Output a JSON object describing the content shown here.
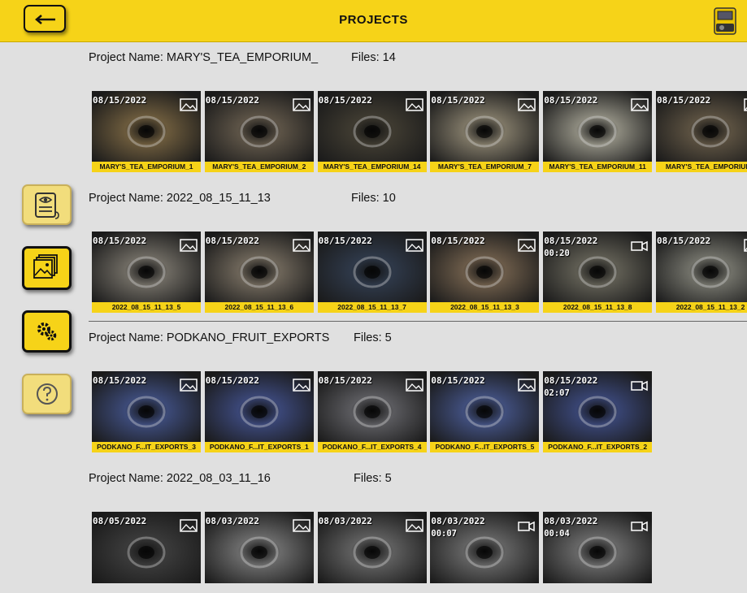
{
  "header": {
    "title": "PROJECTS",
    "back_icon": "arrow-left-icon",
    "device_icon": "camera-device-icon"
  },
  "sidebar": {
    "buttons": [
      {
        "name": "report-button",
        "icon": "report-eye-icon",
        "state": "inactive"
      },
      {
        "name": "gallery-button",
        "icon": "gallery-icon",
        "state": "active"
      },
      {
        "name": "settings-button",
        "icon": "gears-icon",
        "state": "active"
      },
      {
        "name": "help-button",
        "icon": "question-icon",
        "state": "inactive"
      }
    ]
  },
  "projects": [
    {
      "name": "Project Name: MARY'S_TEA_EMPORIUM_",
      "files": "Files: 14",
      "thumbs": [
        {
          "date": "08/15/2022",
          "duration": "",
          "label": "MARY'S_TEA_EMPORIUM_1",
          "kind": "photo",
          "tone": "#6b5a3c"
        },
        {
          "date": "08/15/2022",
          "duration": "",
          "label": "MARY'S_TEA_EMPORIUM_2",
          "kind": "photo",
          "tone": "#5c5346"
        },
        {
          "date": "08/15/2022",
          "duration": "",
          "label": "MARY'S_TEA_EMPORIUM_14",
          "kind": "photo",
          "tone": "#3e3a30"
        },
        {
          "date": "08/15/2022",
          "duration": "",
          "label": "MARY'S_TEA_EMPORIUM_7",
          "kind": "photo",
          "tone": "#7d7665"
        },
        {
          "date": "08/15/2022",
          "duration": "",
          "label": "MARY'S_TEA_EMPORIUM_11",
          "kind": "photo",
          "tone": "#8c8a7e"
        },
        {
          "date": "08/15/2022",
          "duration": "",
          "label": "MARY'S_TEA_EMPORIUM_",
          "kind": "photo",
          "tone": "#5a5040"
        }
      ]
    },
    {
      "name": "Project Name: 2022_08_15_11_13",
      "files": "Files: 10",
      "thumbs": [
        {
          "date": "08/15/2022",
          "duration": "",
          "label": "2022_08_15_11_13_5",
          "kind": "photo",
          "tone": "#6e6a62"
        },
        {
          "date": "08/15/2022",
          "duration": "",
          "label": "2022_08_15_11_13_6",
          "kind": "photo",
          "tone": "#6c6458"
        },
        {
          "date": "08/15/2022",
          "duration": "",
          "label": "2022_08_15_11_13_7",
          "kind": "photo",
          "tone": "#2e3848"
        },
        {
          "date": "08/15/2022",
          "duration": "",
          "label": "2022_08_15_11_13_3",
          "kind": "photo",
          "tone": "#6a5a48"
        },
        {
          "date": "08/15/2022",
          "duration": "00:20",
          "label": "2022_08_15_11_13_8",
          "kind": "video",
          "tone": "#5e5c52"
        },
        {
          "date": "08/15/2022",
          "duration": "",
          "label": "2022_08_15_11_13_2",
          "kind": "photo",
          "tone": "#707068"
        }
      ]
    },
    {
      "name": "Project Name: PODKANO_FRUIT_EXPORTS",
      "files": "Files: 5",
      "thumbs": [
        {
          "date": "08/15/2022",
          "duration": "",
          "label": "PODKANO_F...IT_EXPORTS_3",
          "kind": "photo",
          "tone": "#3c4a78"
        },
        {
          "date": "08/15/2022",
          "duration": "",
          "label": "PODKANO_F...IT_EXPORTS_1",
          "kind": "photo",
          "tone": "#3a4676"
        },
        {
          "date": "08/15/2022",
          "duration": "",
          "label": "PODKANO_F...IT_EXPORTS_4",
          "kind": "photo",
          "tone": "#5a5a5e"
        },
        {
          "date": "08/15/2022",
          "duration": "",
          "label": "PODKANO_F...IT_EXPORTS_5",
          "kind": "photo",
          "tone": "#404e7c"
        },
        {
          "date": "08/15/2022",
          "duration": "02:07",
          "label": "PODKANO_F...IT_EXPORTS_2",
          "kind": "video",
          "tone": "#384472"
        }
      ]
    },
    {
      "name": "Project Name: 2022_08_03_11_16",
      "files": "Files: 5",
      "thumbs": [
        {
          "date": "08/05/2022",
          "duration": "",
          "label": "",
          "kind": "photo",
          "tone": "#3a3a3a"
        },
        {
          "date": "08/03/2022",
          "duration": "",
          "label": "",
          "kind": "photo",
          "tone": "#6a6a6a"
        },
        {
          "date": "08/03/2022",
          "duration": "",
          "label": "",
          "kind": "photo",
          "tone": "#5e5e5e"
        },
        {
          "date": "08/03/2022",
          "duration": "00:07",
          "label": "",
          "kind": "video",
          "tone": "#626262"
        },
        {
          "date": "08/03/2022",
          "duration": "00:04",
          "label": "",
          "kind": "video",
          "tone": "#666666"
        }
      ]
    }
  ]
}
